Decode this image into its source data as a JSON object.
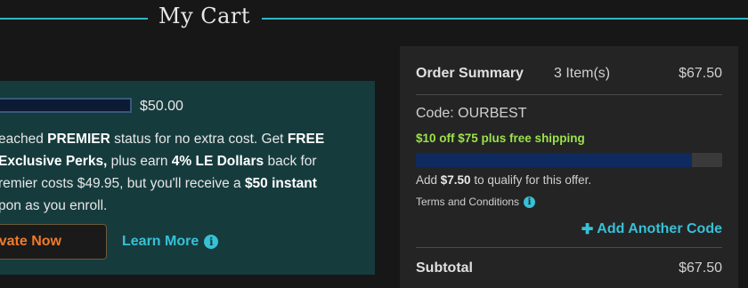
{
  "header": {
    "title": "My Cart"
  },
  "promo": {
    "progress_value": "$50.00",
    "text": {
      "l1_a": "eached ",
      "l1_b": "PREMIER",
      "l1_c": " status for no extra cost. Get ",
      "l1_d": "FREE",
      "l2_a": "Exclusive Perks,",
      "l2_b": " plus earn ",
      "l2_c": "4% LE Dollars",
      "l2_d": " back for",
      "l3_a": "remier costs $49.95, but you'll receive a ",
      "l3_b": "$50 instant",
      "l4": "pon as you enroll."
    },
    "activate_label": "vate Now",
    "learn_more_label": "Learn More"
  },
  "summary": {
    "title": "Order Summary",
    "items": "3 Item(s)",
    "total": "$67.50",
    "code": "Code: OURBEST",
    "offer": "$10 off $75 plus free shipping",
    "offer_progress_fraction": 0.9,
    "qualify_prefix": "Add ",
    "qualify_amount": "$7.50",
    "qualify_suffix": " to qualify for this offer.",
    "terms": "Terms and Conditions",
    "add_code_label": "Add Another Code",
    "subtotal_label": "Subtotal",
    "subtotal_value": "$67.50"
  },
  "colors": {
    "accent": "#36c1d6",
    "promo_bg": "#163b3d",
    "offer_green": "#9be24a",
    "cta_orange": "#f07a2a"
  },
  "icons": [
    "info-icon",
    "plus-icon"
  ]
}
